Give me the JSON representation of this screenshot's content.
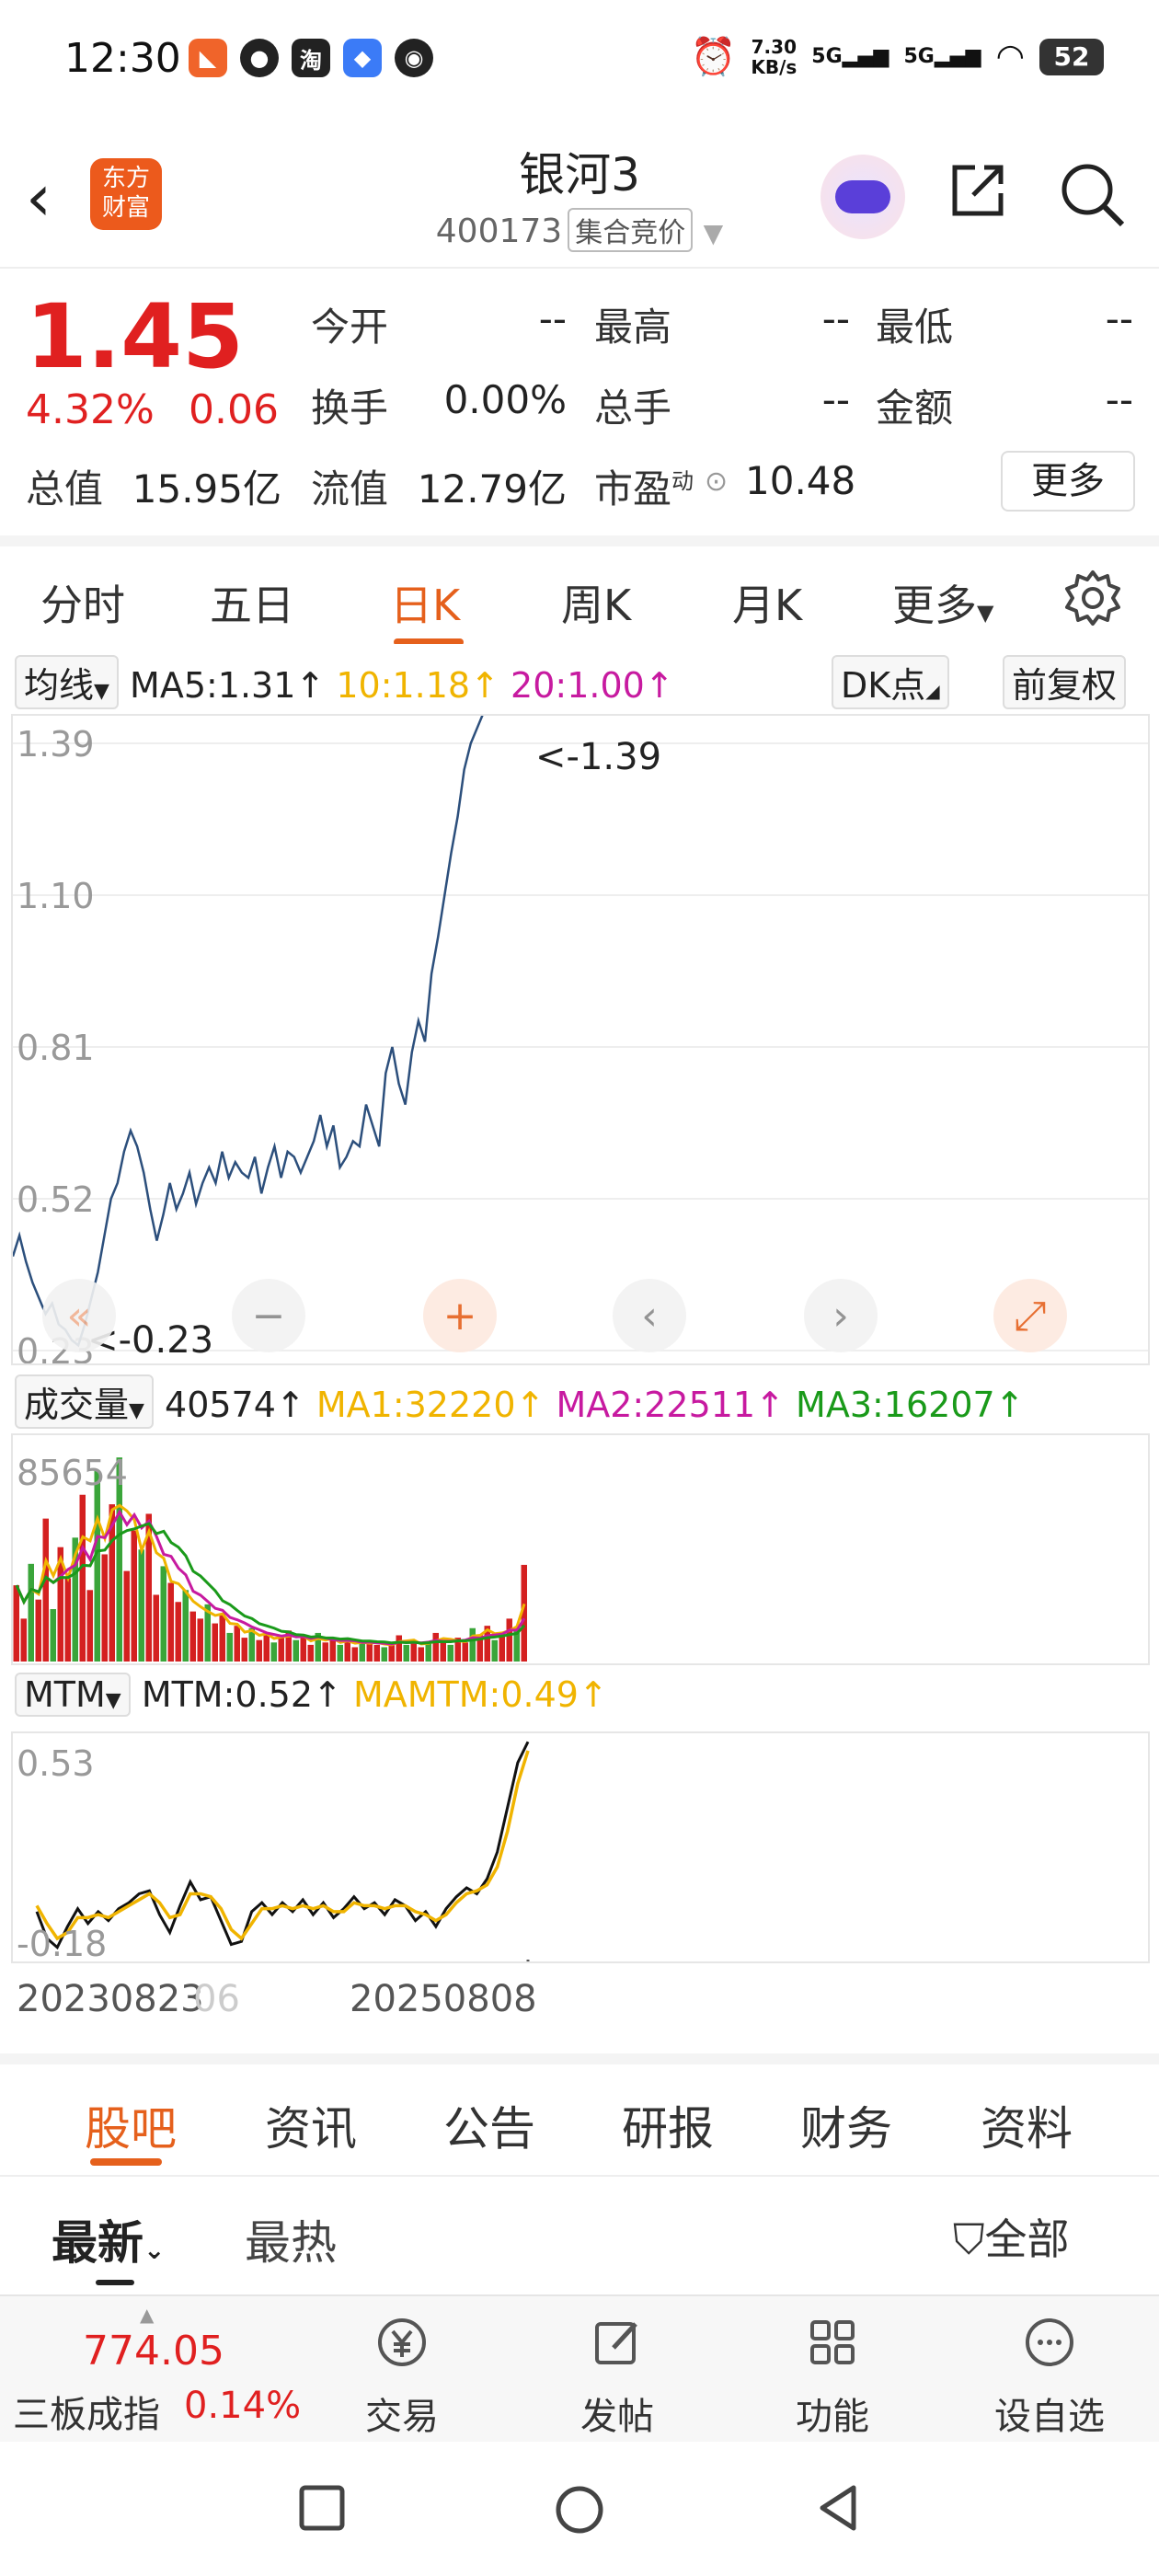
{
  "status_bar": {
    "time": "12:30",
    "net_speed_value": "7.30",
    "net_speed_unit": "KB/s",
    "signal1": "5G",
    "signal2": "5G",
    "battery": "52"
  },
  "header": {
    "title": "银河3",
    "code": "400173",
    "auction_label": "集合竞价",
    "logo_line1": "东方",
    "logo_line2": "财富"
  },
  "quote": {
    "price": "1.45",
    "change_pct": "4.32%",
    "change": "0.06",
    "open_label": "今开",
    "open": "--",
    "high_label": "最高",
    "high": "--",
    "low_label": "最低",
    "low": "--",
    "turnover_rate_label": "换手",
    "turnover_rate": "0.00%",
    "volume_label": "总手",
    "volume": "--",
    "amount_label": "金额",
    "amount": "--",
    "mkt_cap_label": "总值",
    "mkt_cap": "15.95亿",
    "float_cap_label": "流值",
    "float_cap": "12.79亿",
    "pe_label": "市盈",
    "pe_sup": "动",
    "pe": "10.48",
    "more_label": "更多"
  },
  "chart_tabs": [
    {
      "label": "分时"
    },
    {
      "label": "五日"
    },
    {
      "label": "日K"
    },
    {
      "label": "周K"
    },
    {
      "label": "月K"
    },
    {
      "label": "更多"
    }
  ],
  "ma_bar": {
    "selector": "均线",
    "ma5": "MA5:1.31",
    "ma10": "10:1.18",
    "ma20": "20:1.00",
    "dk": "DK点",
    "adjust": "前复权"
  },
  "vol_bar": {
    "selector": "成交量",
    "vol": "40574",
    "ma1": "MA1:32220",
    "ma2": "MA2:22511",
    "ma3": "MA3:16207"
  },
  "mtm_bar": {
    "selector": "MTM",
    "mtm": "MTM:0.52",
    "mamtm": "MAMTM:0.49"
  },
  "colors": {
    "accent": "#e5601c",
    "up": "#e02020",
    "ma5": "#333333",
    "ma10": "#f0b400",
    "ma20": "#c71aa0",
    "ma3": "#1a9a1a",
    "line": "#2c4f7c"
  },
  "chart_data": [
    {
      "type": "line",
      "y_ticks": [
        "1.39",
        "1.10",
        "0.81",
        "0.52",
        "0.23"
      ],
      "ylim": [
        0.23,
        1.39
      ],
      "annotations": [
        "<-1.39",
        "<-0.23"
      ],
      "x": [
        0,
        4,
        8,
        12,
        16,
        20,
        24,
        28,
        32,
        36,
        40,
        44,
        48,
        52,
        56,
        60,
        64,
        68,
        72,
        76,
        80,
        84,
        88,
        92,
        96,
        100,
        104,
        108,
        112,
        116,
        120,
        124,
        128,
        132,
        136,
        140,
        144,
        148,
        152,
        156,
        160,
        164,
        168,
        172,
        176,
        180,
        184,
        188,
        192,
        196,
        200,
        204,
        208,
        212,
        216,
        220,
        224,
        228,
        232,
        236,
        240,
        244,
        248,
        252,
        256,
        260,
        264,
        268,
        272,
        276,
        280,
        284,
        288,
        292,
        296,
        300,
        304,
        308,
        312,
        315
      ],
      "values": [
        0.41,
        0.45,
        0.4,
        0.36,
        0.33,
        0.3,
        0.32,
        0.28,
        0.27,
        0.25,
        0.24,
        0.28,
        0.33,
        0.38,
        0.45,
        0.52,
        0.55,
        0.61,
        0.65,
        0.62,
        0.57,
        0.5,
        0.44,
        0.49,
        0.55,
        0.5,
        0.53,
        0.57,
        0.51,
        0.55,
        0.58,
        0.55,
        0.61,
        0.56,
        0.59,
        0.57,
        0.56,
        0.6,
        0.53,
        0.58,
        0.62,
        0.56,
        0.61,
        0.6,
        0.57,
        0.6,
        0.63,
        0.68,
        0.62,
        0.66,
        0.58,
        0.6,
        0.63,
        0.62,
        0.7,
        0.66,
        0.62,
        0.76,
        0.81,
        0.74,
        0.7,
        0.8,
        0.86,
        0.82,
        0.95,
        1.02,
        1.1,
        1.18,
        1.25,
        1.34,
        1.39,
        1.42,
        1.45,
        1.45,
        1.45,
        1.45,
        1.45,
        1.45,
        1.45,
        1.45
      ]
    },
    {
      "type": "bar",
      "title": "成交量",
      "y_ticks": [
        "85654"
      ],
      "ylim": [
        0,
        95000
      ],
      "values": [
        32000,
        18000,
        41000,
        26000,
        60000,
        22000,
        48000,
        35000,
        52000,
        70000,
        30000,
        80000,
        45000,
        66000,
        85654,
        38000,
        55000,
        47000,
        62000,
        28000,
        40000,
        33000,
        25000,
        30000,
        21000,
        18000,
        24000,
        16000,
        20000,
        12000,
        15000,
        10000,
        14000,
        9000,
        12000,
        8000,
        11000,
        13000,
        9000,
        10000,
        7000,
        12000,
        8000,
        9000,
        7000,
        10000,
        6000,
        8000,
        9000,
        7000,
        6000,
        8000,
        11000,
        7000,
        9000,
        6000,
        8000,
        12000,
        9000,
        7000,
        10000,
        8000,
        14000,
        11000,
        15000,
        9000,
        12000,
        18000,
        14000,
        40574
      ]
    },
    {
      "type": "line",
      "title": "MTM",
      "y_ticks": [
        "0.53",
        "-0.18"
      ],
      "ylim": [
        -0.18,
        0.53
      ],
      "x_ticks": [
        "20230823",
        "06",
        "20250808"
      ],
      "series": [
        {
          "name": "MTM",
          "values": [
            -0.05,
            -0.14,
            -0.17,
            -0.1,
            -0.04,
            -0.09,
            -0.05,
            -0.08,
            -0.04,
            -0.02,
            0.01,
            0.02,
            -0.06,
            -0.12,
            -0.03,
            0.05,
            -0.01,
            0.0,
            -0.08,
            -0.16,
            -0.15,
            -0.05,
            -0.02,
            -0.06,
            -0.02,
            -0.05,
            -0.01,
            -0.06,
            -0.02,
            -0.07,
            -0.04,
            0.0,
            -0.04,
            -0.02,
            -0.06,
            -0.01,
            -0.03,
            -0.08,
            -0.05,
            -0.1,
            -0.04,
            0.0,
            0.03,
            0.01,
            0.06,
            0.15,
            0.3,
            0.45,
            0.52
          ]
        },
        {
          "name": "MAMTM",
          "values": [
            -0.03,
            -0.09,
            -0.14,
            -0.12,
            -0.07,
            -0.07,
            -0.06,
            -0.07,
            -0.05,
            -0.03,
            -0.01,
            0.01,
            -0.02,
            -0.07,
            -0.06,
            0.01,
            0.01,
            0.0,
            -0.04,
            -0.11,
            -0.14,
            -0.09,
            -0.04,
            -0.04,
            -0.03,
            -0.04,
            -0.03,
            -0.04,
            -0.03,
            -0.05,
            -0.05,
            -0.02,
            -0.03,
            -0.03,
            -0.04,
            -0.03,
            -0.03,
            -0.05,
            -0.06,
            -0.08,
            -0.06,
            -0.02,
            0.01,
            0.02,
            0.04,
            0.1,
            0.22,
            0.38,
            0.49
          ]
        }
      ]
    }
  ],
  "bottom_tabs": [
    {
      "label": "股吧"
    },
    {
      "label": "资讯"
    },
    {
      "label": "公告"
    },
    {
      "label": "研报"
    },
    {
      "label": "财务"
    },
    {
      "label": "资料"
    }
  ],
  "sub_tabs": {
    "newest": "最新",
    "hottest": "最热",
    "filter": "全部"
  },
  "bottom_nav": {
    "index_value": "774.05",
    "index_name": "三板成指",
    "index_change": "0.14%",
    "items": [
      {
        "label": "交易"
      },
      {
        "label": "发帖"
      },
      {
        "label": "功能"
      },
      {
        "label": "设自选"
      }
    ]
  }
}
